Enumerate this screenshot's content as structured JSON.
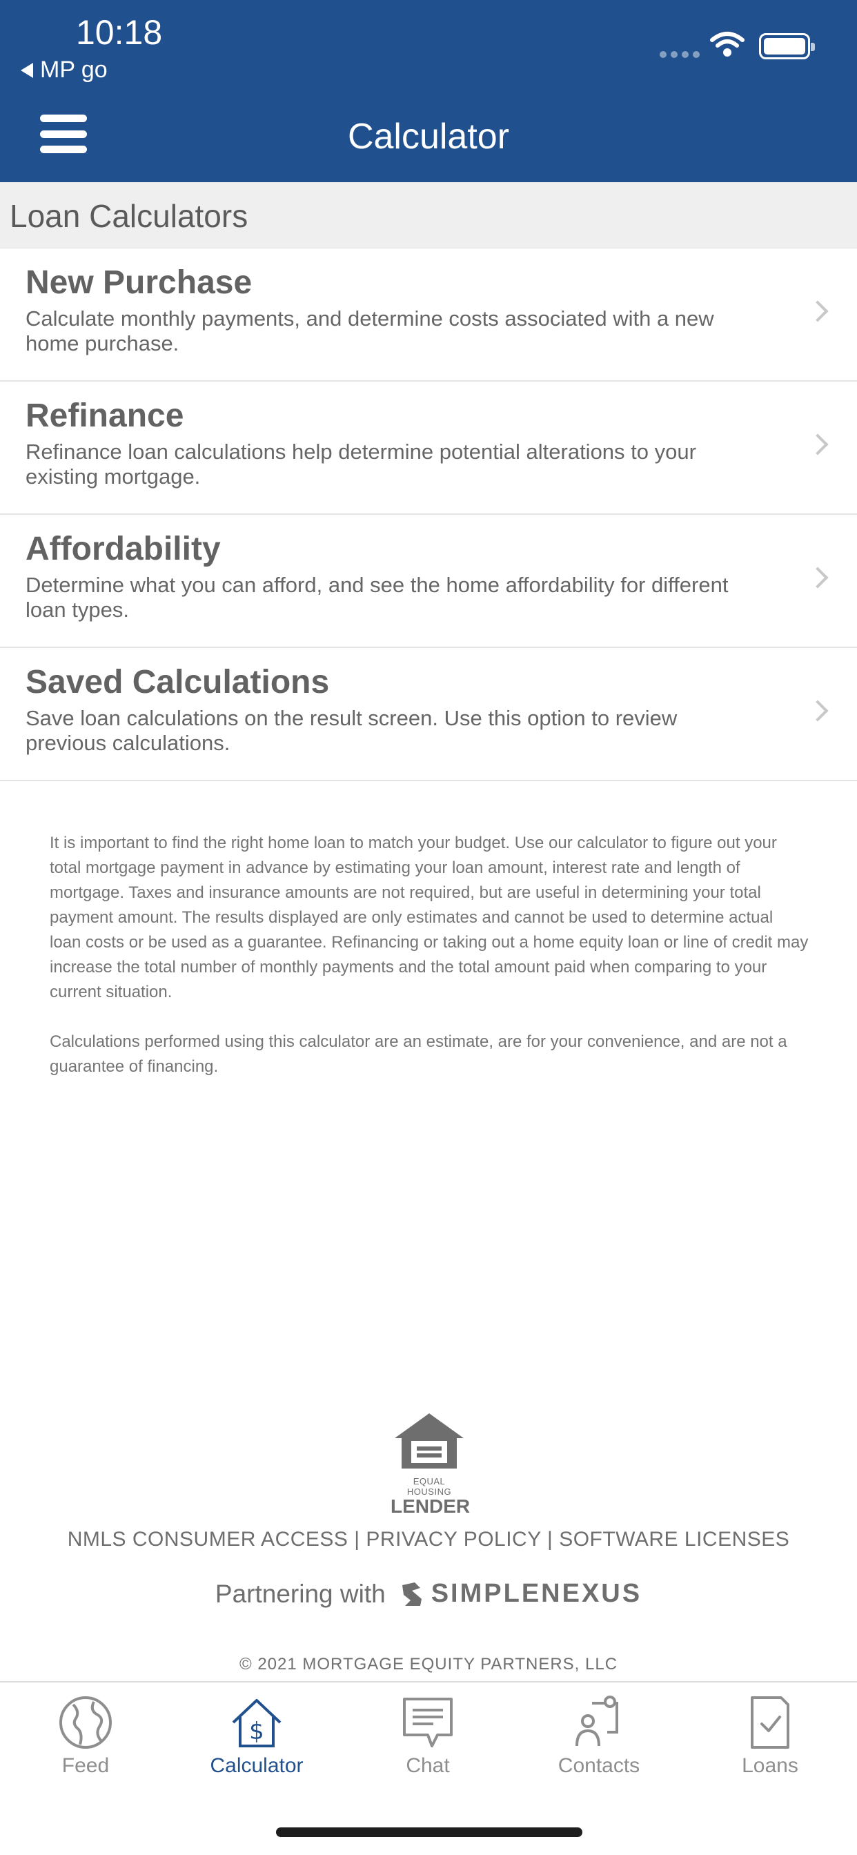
{
  "status": {
    "time": "10:18",
    "back_label": "MP go"
  },
  "header": {
    "title": "Calculator"
  },
  "section": {
    "title": "Loan Calculators"
  },
  "items": [
    {
      "title": "New Purchase",
      "desc": "Calculate monthly payments, and determine costs associated with a new home purchase."
    },
    {
      "title": "Refinance",
      "desc": "Refinance loan calculations help determine potential alterations to your existing mortgage."
    },
    {
      "title": "Affordability",
      "desc": "Determine what you can afford, and see the home affordability for different loan types."
    },
    {
      "title": "Saved Calculations",
      "desc": "Save loan calculations on the result screen. Use this option to review previous calculations."
    }
  ],
  "disclaimer": {
    "p1": "It is important to find the right home loan to match your budget. Use our calculator to figure out your total mortgage payment in advance by estimating your loan amount, interest rate and length of mortgage. Taxes and insurance amounts are not required, but are useful in determining your total payment amount. The results displayed are only estimates and cannot be used to determine actual loan costs or be used as a guarantee. Refinancing or taking out a home equity loan or line of credit may increase the total number of monthly payments and the total amount paid when comparing to your current situation.",
    "p2": "Calculations performed using this calculator are an estimate, are for your convenience, and are not a guarantee of financing."
  },
  "footer": {
    "ehl_small": "EQUAL HOUSING",
    "ehl_big": "LENDER",
    "links": [
      "NMLS CONSUMER ACCESS",
      "PRIVACY POLICY",
      "SOFTWARE LICENSES"
    ],
    "separator": "|",
    "partner_text": "Partnering with",
    "brand": "SIMPLENEXUS",
    "copyright": "© 2021 MORTGAGE EQUITY PARTNERS, LLC"
  },
  "tabs": [
    {
      "label": "Feed",
      "icon": "globe-icon"
    },
    {
      "label": "Calculator",
      "icon": "house-dollar-icon",
      "active": true
    },
    {
      "label": "Chat",
      "icon": "chat-icon"
    },
    {
      "label": "Contacts",
      "icon": "contacts-icon"
    },
    {
      "label": "Loans",
      "icon": "document-check-icon"
    }
  ],
  "colors": {
    "header_bg": "#21508e",
    "active_tab": "#21508e",
    "inactive_tab": "#8e8e8e",
    "section_bg": "#efefef"
  }
}
